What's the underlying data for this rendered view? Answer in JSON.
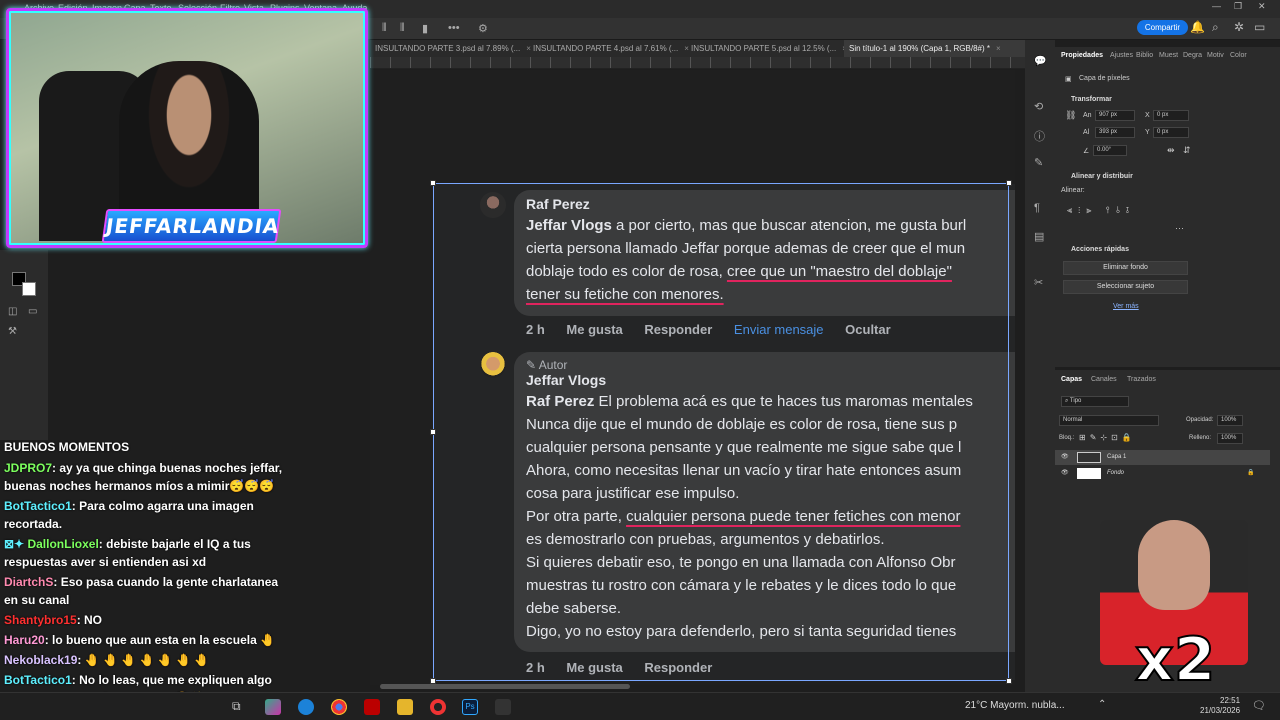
{
  "menu": [
    "Archivo",
    "Edición",
    "Imagen",
    "Capa",
    "Texto",
    "Selección",
    "Filtro",
    "Vista",
    "Plugins",
    "Ventana",
    "Ayuda"
  ],
  "share_label": "Compartir",
  "tabs": [
    {
      "label": "INSULTANDO PARTE 3.psd al 7.89% (..."
    },
    {
      "label": "INSULTANDO PARTE 4.psd al 7.61% (..."
    },
    {
      "label": "INSULTANDO PARTE 5.psd al 12.5% (..."
    },
    {
      "label": "Sin título-1 al 190% (Capa 1, RGB/8#) *"
    }
  ],
  "overlay_logo": "JEFFARLANDIA",
  "chat": {
    "title": "BUENOS MOMENTOS",
    "messages": [
      {
        "user": "JDPRO7",
        "color": "#7cff5e",
        "text": ": ay ya que chinga buenas noches jeffar, buenas noches hermanos míos a mimir😴😴😴"
      },
      {
        "user": "BotTactico1",
        "color": "#5ef0ff",
        "text": ": Para colmo agarra una imagen recortada."
      },
      {
        "user": "DallonLioxel",
        "color": "#7cff5e",
        "text": ": debiste bajarle el IQ a tus respuestas aver si entienden asi xd"
      },
      {
        "user": "DiartchS",
        "color": "#ff8ab0",
        "text": ": Eso pasa cuando la gente charlatanea en su canal"
      },
      {
        "user": "Shantybro15",
        "color": "#ff3030",
        "text": ": NO"
      },
      {
        "user": "Haru20",
        "color": "#ff9ad5",
        "text": ": lo bueno que aun esta en la escuela 🤚"
      },
      {
        "user": "Nekoblack19",
        "color": "#d9c3ff",
        "text": ": 🤚 🤚 🤚 🤚 🤚 🤚 🤚"
      },
      {
        "user": "BotTactico1",
        "color": "#5ef0ff",
        "text": ": No lo leas, que me expliquen algo que ya se mata mis neuronas 🤤✨"
      }
    ]
  },
  "comment1": {
    "name": "Raf Perez",
    "lines": [
      {
        "bold": "Jeffar Vlogs",
        "text": " a por cierto, mas que buscar atencion, me gusta burl"
      },
      {
        "text": "cierta persona llamado Jeffar porque ademas de creer que el mun"
      },
      {
        "text": "doblaje todo es color de rosa, ",
        "hl": "cree que un \"maestro del doblaje\""
      },
      {
        "hl": "tener su fetiche con menores."
      }
    ],
    "time": "2 h",
    "like": "Me gusta",
    "reply": "Responder",
    "send": "Enviar mensaje",
    "hide": "Ocultar"
  },
  "comment2": {
    "badge": "Autor",
    "name": "Jeffar Vlogs",
    "lines": [
      {
        "bold": "Raf Perez",
        "text": " El problema acá es que te haces tus maromas mentales"
      },
      {
        "text": "Nunca dije que el mundo de doblaje es color de rosa, tiene sus p"
      },
      {
        "text": "cualquier persona pensante y que realmente me sigue sabe que l"
      },
      {
        "text": "Ahora, como necesitas llenar un vacío y tirar hate entonces asum"
      },
      {
        "text": "cosa para justificar ese impulso."
      },
      {
        "text": "Por otra parte, ",
        "hl": "cualquier persona puede tener fetiches con menor"
      },
      {
        "text": "es demostrarlo con pruebas, argumentos y debatirlos."
      },
      {
        "text": "Si quieres debatir eso, te pongo en una llamada con Alfonso Obr"
      },
      {
        "text": "muestras tu rostro con cámara y le rebates y le dices todo lo que"
      },
      {
        "text": "debe saberse."
      },
      {
        "text": "Digo, yo no estoy para defenderlo, pero si tanta seguridad tienes"
      }
    ],
    "time": "2 h",
    "like": "Me gusta",
    "reply": "Responder"
  },
  "properties": {
    "tabs": [
      "Propiedades",
      "Ajustes",
      "Biblio",
      "Muest",
      "Degra",
      "Motiv",
      "Color"
    ],
    "layer_type": "Capa de píxeles",
    "transform_title": "Transformar",
    "w_label": "An",
    "w": "907 px",
    "h_label": "Al",
    "h": "393 px",
    "x_label": "X",
    "x": "0 px",
    "y_label": "Y",
    "y": "0 px",
    "angle": "0.00°",
    "align_title": "Alinear y distribuir",
    "align_sub": "Alinear:",
    "quick_title": "Acciones rápidas",
    "remove_bg": "Eliminar fondo",
    "select_subject": "Seleccionar sujeto",
    "more": "Ver más"
  },
  "layers": {
    "tabs": [
      "Capas",
      "Canales",
      "Trazados"
    ],
    "search": "Tipo",
    "blend": "Normal",
    "opacity_label": "Opacidad:",
    "opacity": "100%",
    "lock_label": "Bloq.:",
    "fill_label": "Relleno:",
    "fill": "100%",
    "items": [
      "Capa 1",
      "Fondo"
    ]
  },
  "meme_text": "x2",
  "taskbar": {
    "weather": "21°C  Mayorm. nubla...",
    "time": "22:51",
    "date": "21/03/2026"
  }
}
